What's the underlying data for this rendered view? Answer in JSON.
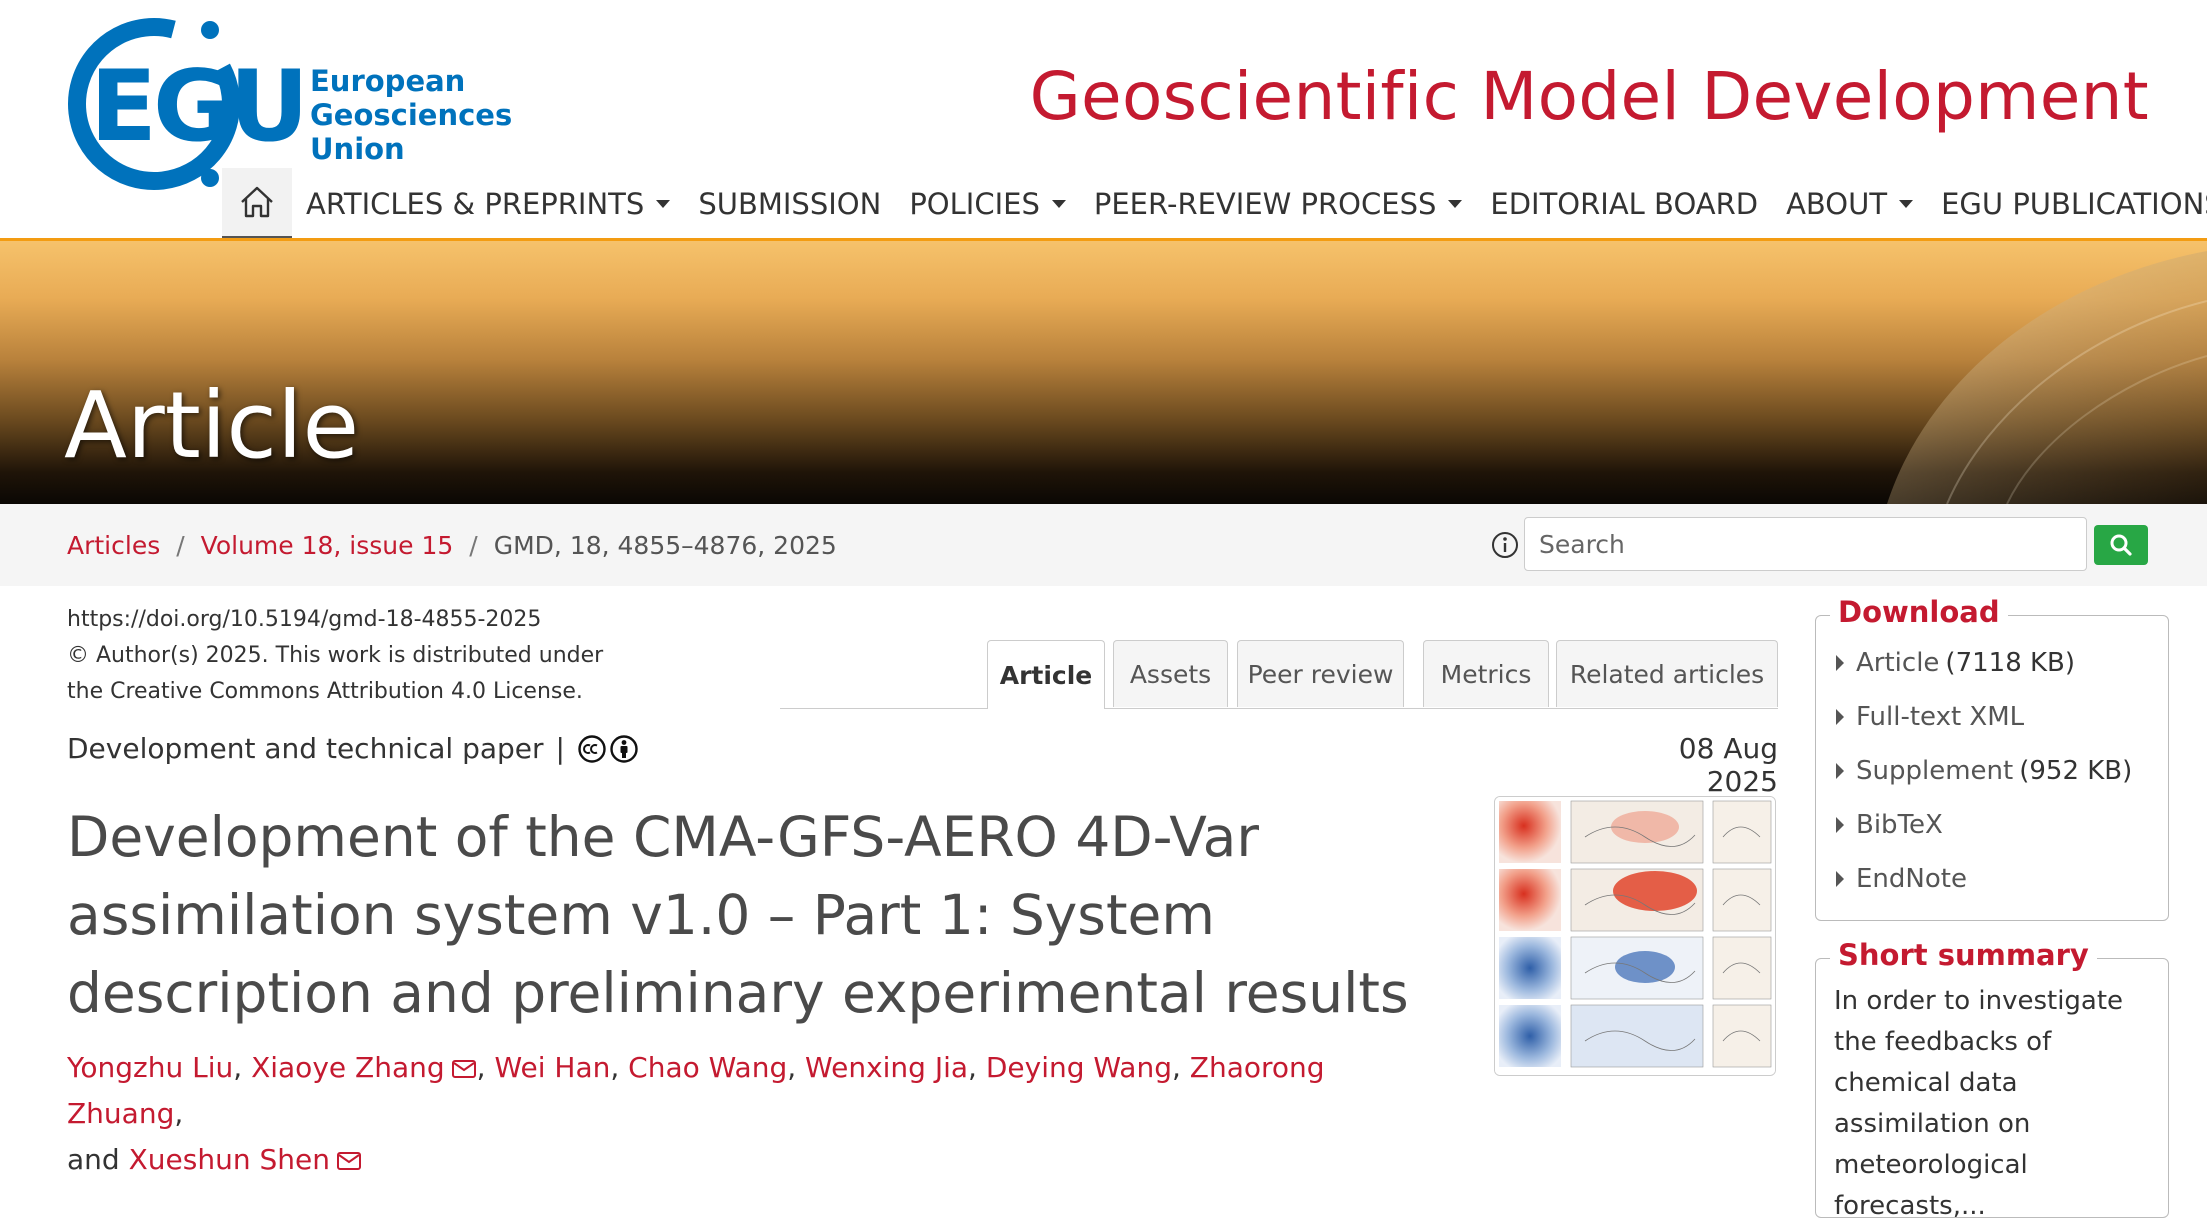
{
  "header": {
    "logo": {
      "line1": "European",
      "line2": "Geosciences",
      "line3": "Union",
      "mark_letters": "EGU"
    },
    "journal_title": "Geoscientific Model Development",
    "nav": {
      "home_icon": "home-icon",
      "items": [
        {
          "label": "ARTICLES & PREPRINTS",
          "dropdown": true
        },
        {
          "label": "SUBMISSION",
          "dropdown": false
        },
        {
          "label": "POLICIES",
          "dropdown": true
        },
        {
          "label": "PEER-REVIEW PROCESS",
          "dropdown": true
        },
        {
          "label": "EDITORIAL BOARD",
          "dropdown": false
        },
        {
          "label": "ABOUT",
          "dropdown": true
        },
        {
          "label": "EGU PUBLICATIONS",
          "dropdown": false
        }
      ],
      "login_icon": "login-icon"
    },
    "accent_color": "#c41a30",
    "brand_color": "#0072bc",
    "nav_underline_color": "#f39c12"
  },
  "banner": {
    "title": "Article"
  },
  "breadcrumb": {
    "items": [
      {
        "label": "Articles",
        "link": true
      },
      {
        "label": "Volume 18, issue 15",
        "link": true
      },
      {
        "label": "GMD, 18, 4855–4876, 2025",
        "link": false
      }
    ],
    "separator": "/"
  },
  "search": {
    "placeholder": "Search",
    "value": "",
    "button_icon": "search-icon",
    "button_color": "#28a745"
  },
  "article": {
    "doi": "https://doi.org/10.5194/gmd-18-4855-2025",
    "license_line1": "© Author(s) 2025. This work is distributed under",
    "license_line2": "the Creative Commons Attribution 4.0 License.",
    "paper_type": "Development and technical paper",
    "type_separator": "|",
    "date": "08 Aug 2025",
    "title": "Development of the CMA-GFS-AERO 4D-Var assimilation system v1.0 – Part 1: System description and preliminary experimental results",
    "authors": [
      {
        "name": "Yongzhu Liu",
        "email": false
      },
      {
        "name": "Xiaoye Zhang",
        "email": true
      },
      {
        "name": "Wei Han",
        "email": false
      },
      {
        "name": "Chao Wang",
        "email": false
      },
      {
        "name": "Wenxing Jia",
        "email": false
      },
      {
        "name": "Deying Wang",
        "email": false
      },
      {
        "name": "Zhaorong Zhuang",
        "email": false
      },
      {
        "name": "Xueshun Shen",
        "email": true
      }
    ],
    "author_sep": ", ",
    "author_last_sep": ", ",
    "author_and": "and "
  },
  "tabs": {
    "items": [
      "Article",
      "Assets",
      "Peer review",
      "Metrics",
      "Related articles"
    ],
    "active": "Article"
  },
  "sidebar": {
    "download": {
      "title": "Download",
      "items": [
        {
          "label": "Article",
          "size": "(7118 KB)"
        },
        {
          "label": "Full-text XML",
          "size": ""
        },
        {
          "label": "Supplement",
          "size": "(952 KB)"
        },
        {
          "label": "BibTeX",
          "size": ""
        },
        {
          "label": "EndNote",
          "size": ""
        }
      ]
    },
    "summary": {
      "title": "Short summary",
      "text": "In order to investigate the feedbacks of chemical data assimilation on meteorological forecasts,..."
    }
  }
}
